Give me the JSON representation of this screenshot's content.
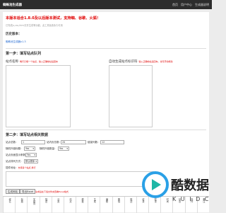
{
  "header": {
    "title": "蜘蛛池生成器",
    "links": [
      "首页",
      "用户中心",
      "生成器说明"
    ]
  },
  "notice": "本版本适合1.8.0及以后版本测试，支持蜘、谷歌、火狐！",
  "subnote": "已完成js,css,html文件生成等功能，此工具免费永久可用",
  "history": {
    "title": "历史版本：",
    "version": "蜘蛛池生成器v1.3"
  },
  "step1": {
    "title": "第一步：填写站点队列",
    "left_label": "站点名称",
    "left_hint": "每行只填一个站点，输入正确地址后回车",
    "right_label": "自动生成站点标识符",
    "right_hint": "输入正确地址后回车，也可手动修改"
  },
  "step2": {
    "title": "第二步：填写站点相关数据",
    "fields": {
      "count_label": "站点总数：",
      "count_value": "1",
      "pages_label": "站内页总数：",
      "pages_value": "20",
      "cols_label": "链接列数：",
      "cols_value": "12",
      "random_label": "随机外链标题：",
      "random_value": "Yes",
      "outer_label": "随机外链数量：",
      "outer_value": "Yes",
      "page_limit_label": "站点页面显示条数：",
      "page_limit_value": "Yes",
      "sort_label": "站点排列方式：",
      "sort_value": "默认顺序",
      "kw_label": "插件地址：",
      "kw_hint": "支持多个站点 换行"
    },
    "keywords_label": "关键词列表：",
    "keywords_hint": "支持多行输入"
  },
  "buttons": {
    "generate": "生成网站",
    "download": "导出Excel",
    "note": "生成后在下载文件夹查看Excel格式"
  },
  "table_headers": [
    "域名",
    "标题",
    "关键词",
    "描述",
    "分类",
    "站点",
    "模板",
    "生成",
    "编辑",
    "删除",
    "推送",
    "收录",
    "权重",
    "时间",
    "状态",
    "操作",
    "备注"
  ],
  "watermark": {
    "cn": "酷数据",
    "en": "K U I D C",
    "colors": {
      "blue": "#2aa0e6",
      "teal": "#1fb7a6"
    }
  }
}
